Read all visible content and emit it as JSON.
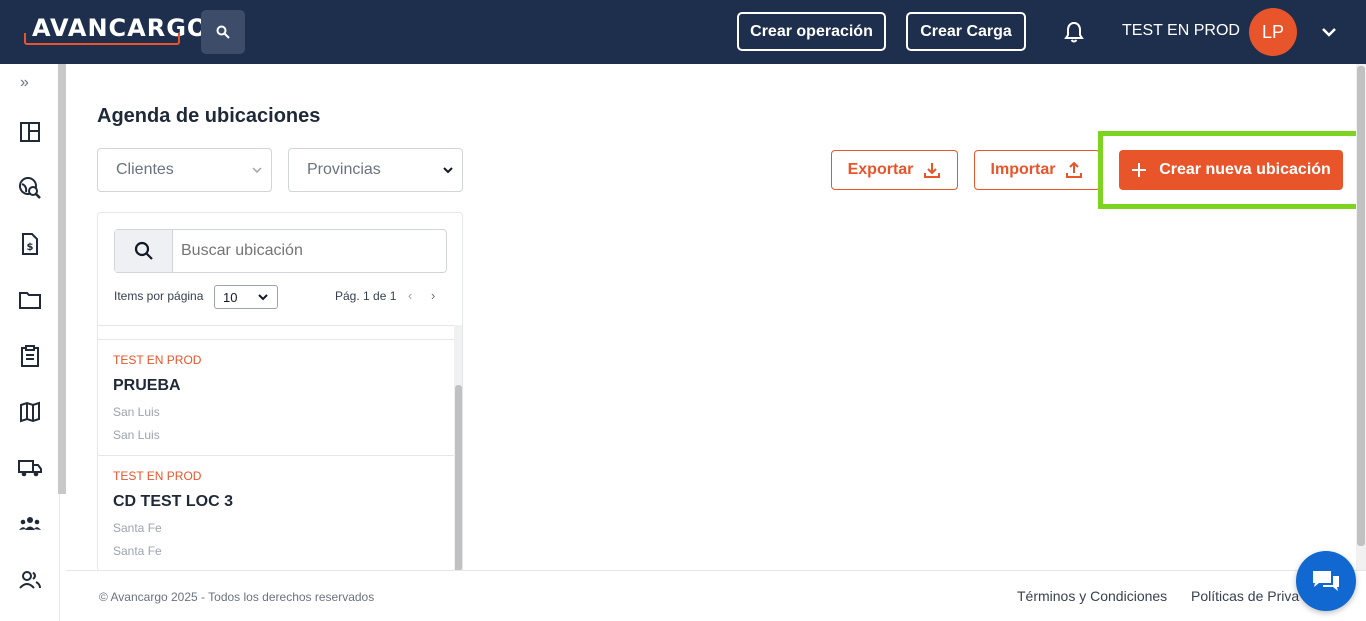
{
  "header": {
    "logo_text": "AVANCARGO",
    "create_operation_label": "Crear operación",
    "create_load_label": "Crear Carga",
    "user_name": "TEST EN PROD",
    "avatar_initials": "LP"
  },
  "sidebar": {
    "toggle": "»",
    "icons": [
      "dashboard-icon",
      "globe-search-icon",
      "invoice-icon",
      "folder-icon",
      "clipboard-icon",
      "map-icon",
      "truck-icon",
      "group-icon",
      "users-icon"
    ]
  },
  "main": {
    "title": "Agenda de ubicaciones",
    "clients_filter": "Clientes",
    "provinces_filter": "Provincias",
    "export_label": "Exportar",
    "import_label": "Importar",
    "create_label": "Crear nueva ubicación",
    "search_placeholder": "Buscar ubicación",
    "items_per_page_label": "Items por página",
    "items_per_page_value": "10",
    "page_info": "Pág. 1 de 1",
    "locations": [
      {
        "client": "TEST EN PROD",
        "name": "PRUEBA",
        "line1": "San Luis",
        "line2": "San Luis"
      },
      {
        "client": "TEST EN PROD",
        "name": "CD TEST LOC 3",
        "line1": "Santa Fe",
        "line2": "Santa Fe"
      }
    ]
  },
  "footer": {
    "copyright": "© Avancargo 2025 - Todos los derechos reservados",
    "terms": "Términos y Condiciones",
    "privacy": "Políticas de Priva"
  },
  "colors": {
    "navy": "#1e2f4d",
    "accent": "#e8552a",
    "highlight": "#7ed321",
    "chat": "#1168d0"
  }
}
